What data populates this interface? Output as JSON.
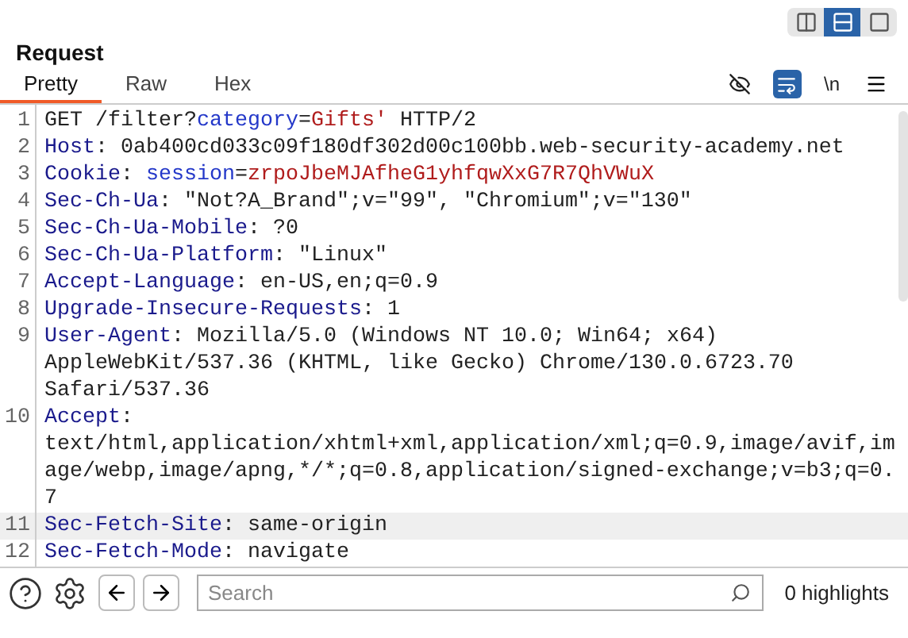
{
  "layout_buttons": [
    {
      "kind": "columns",
      "selected": false
    },
    {
      "kind": "rows",
      "selected": true
    },
    {
      "kind": "single",
      "selected": false
    }
  ],
  "title": "Request",
  "tabs": [
    {
      "label": "Pretty",
      "selected": true
    },
    {
      "label": "Raw",
      "selected": false
    },
    {
      "label": "Hex",
      "selected": false
    }
  ],
  "toolbar": [
    {
      "kind": "hide",
      "selected": false
    },
    {
      "kind": "wrap",
      "selected": true
    },
    {
      "kind": "newline",
      "label": "\\n",
      "selected": false
    },
    {
      "kind": "menu"
    }
  ],
  "lines": [
    {
      "number": "1",
      "highlighted": false,
      "segments": [
        {
          "kind": "text",
          "text": "GET /filter?"
        },
        {
          "kind": "param",
          "text": "category"
        },
        {
          "kind": "text",
          "text": "="
        },
        {
          "kind": "value",
          "text": "Gifts'"
        },
        {
          "kind": "text",
          "text": " HTTP/2"
        }
      ]
    },
    {
      "number": "2",
      "highlighted": false,
      "segments": [
        {
          "kind": "header",
          "text": "Host"
        },
        {
          "kind": "text",
          "text": ": 0ab400cd033c09f180df302d00c100bb.web-security-academy.net"
        }
      ]
    },
    {
      "number": "3",
      "highlighted": false,
      "segments": [
        {
          "kind": "header",
          "text": "Cookie"
        },
        {
          "kind": "text",
          "text": ": "
        },
        {
          "kind": "param",
          "text": "session"
        },
        {
          "kind": "text",
          "text": "="
        },
        {
          "kind": "value",
          "text": "zrpoJbeMJAfheG1yhfqwXxG7R7QhVWuX"
        }
      ]
    },
    {
      "number": "4",
      "highlighted": false,
      "segments": [
        {
          "kind": "header",
          "text": "Sec-Ch-Ua"
        },
        {
          "kind": "text",
          "text": ": \"Not?A_Brand\";v=\"99\", \"Chromium\";v=\"130\""
        }
      ]
    },
    {
      "number": "5",
      "highlighted": false,
      "segments": [
        {
          "kind": "header",
          "text": "Sec-Ch-Ua-Mobile"
        },
        {
          "kind": "text",
          "text": ": ?0"
        }
      ]
    },
    {
      "number": "6",
      "highlighted": false,
      "segments": [
        {
          "kind": "header",
          "text": "Sec-Ch-Ua-Platform"
        },
        {
          "kind": "text",
          "text": ": \"Linux\""
        }
      ]
    },
    {
      "number": "7",
      "highlighted": false,
      "segments": [
        {
          "kind": "header",
          "text": "Accept-Language"
        },
        {
          "kind": "text",
          "text": ": en-US,en;q=0.9"
        }
      ]
    },
    {
      "number": "8",
      "highlighted": false,
      "segments": [
        {
          "kind": "header",
          "text": "Upgrade-Insecure-Requests"
        },
        {
          "kind": "text",
          "text": ": 1"
        }
      ]
    },
    {
      "number": "9",
      "highlighted": false,
      "segments": [
        {
          "kind": "header",
          "text": "User-Agent"
        },
        {
          "kind": "text",
          "text": ": Mozilla/5.0 (Windows NT 10.0; Win64; x64) AppleWebKit/537.36 (KHTML, like Gecko) Chrome/130.0.6723.70 Safari/537.36"
        }
      ]
    },
    {
      "number": "10",
      "highlighted": false,
      "segments": [
        {
          "kind": "header",
          "text": "Accept"
        },
        {
          "kind": "text",
          "text": ": text/html,application/xhtml+xml,application/xml;q=0.9,image/avif,image/webp,image/apng,*/*;q=0.8,application/signed-exchange;v=b3;q=0.7"
        }
      ]
    },
    {
      "number": "11",
      "highlighted": true,
      "segments": [
        {
          "kind": "header",
          "text": "Sec-Fetch-Site"
        },
        {
          "kind": "text",
          "text": ": same-origin"
        }
      ]
    },
    {
      "number": "12",
      "highlighted": false,
      "segments": [
        {
          "kind": "header",
          "text": "Sec-Fetch-Mode"
        },
        {
          "kind": "text",
          "text": ": navigate"
        }
      ]
    }
  ],
  "search": {
    "placeholder": "Search"
  },
  "highlights": "0 highlights"
}
